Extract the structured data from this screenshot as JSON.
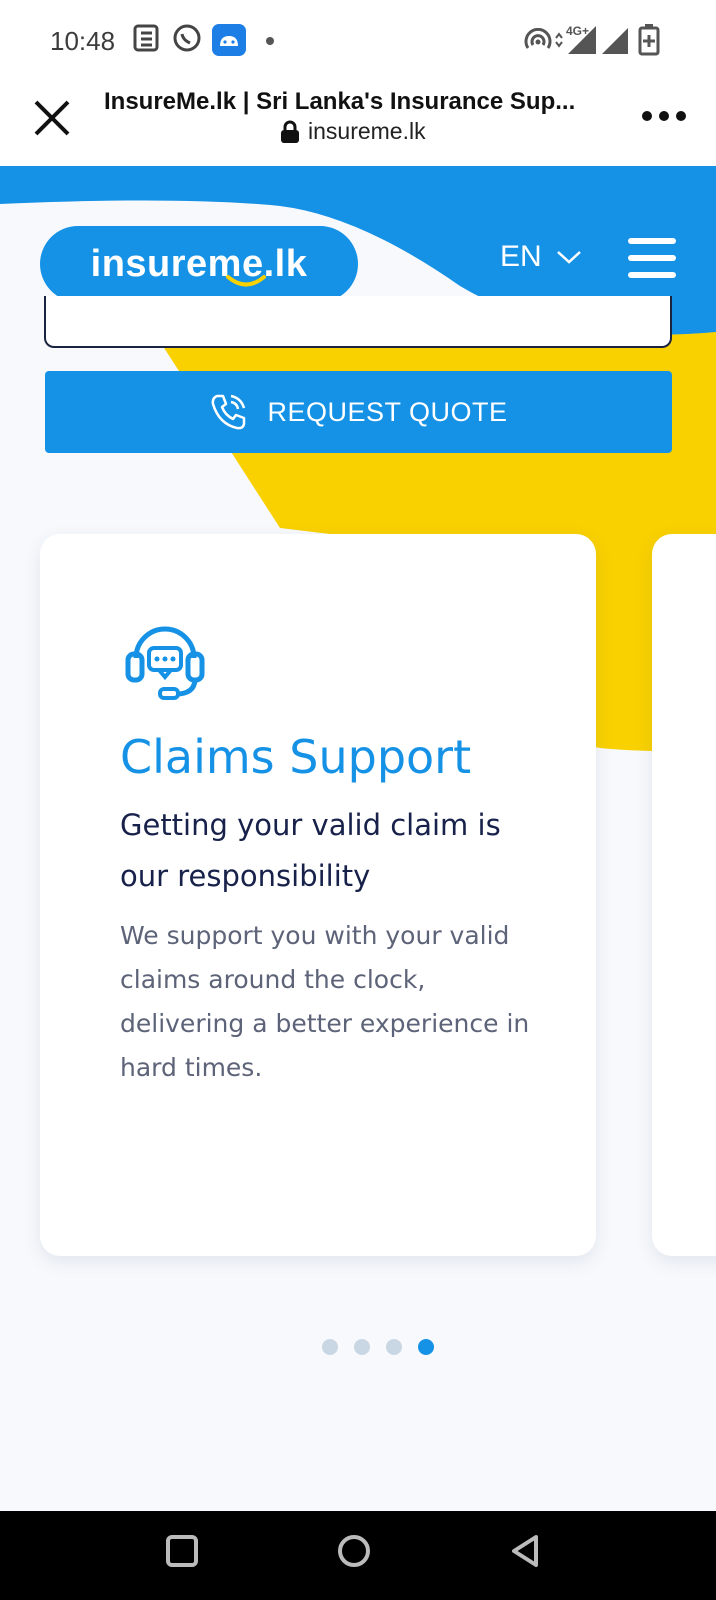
{
  "status_bar": {
    "time": "10:48",
    "icons": [
      "news-icon",
      "whatsapp-icon",
      "android-icon",
      "hotspot-icon",
      "signal-4g-icon",
      "signal-icon",
      "battery-icon"
    ],
    "network_label": "4G+"
  },
  "browser": {
    "title": "InsureMe.lk | Sri Lanka's Insurance Sup...",
    "url": "insureme.lk"
  },
  "header": {
    "logo": "insureme.lk",
    "language": "EN"
  },
  "request_quote": {
    "label": "REQUEST QUOTE"
  },
  "card": {
    "title": "Claims Support",
    "subtitle": "Getting your valid claim is our responsibility",
    "description": "We support you with your valid claims around the clock, delivering a better experience in hard times."
  },
  "carousel": {
    "count": 4,
    "active_index": 3
  },
  "colors": {
    "primary_blue": "#1592e6",
    "yellow": "#f9d100",
    "navy": "#17214a"
  }
}
